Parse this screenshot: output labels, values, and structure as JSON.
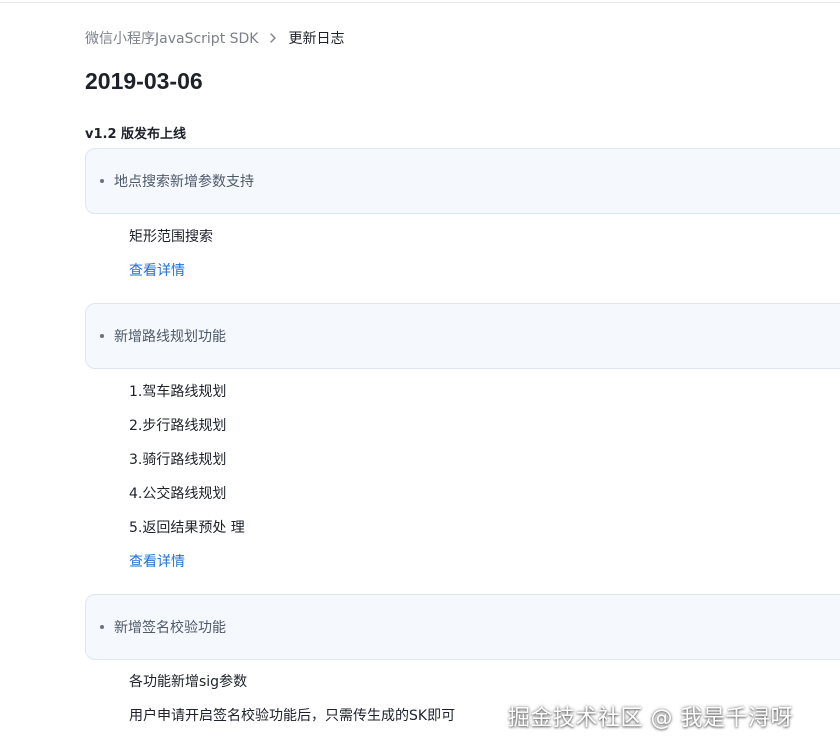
{
  "breadcrumb": {
    "parent": "微信小程序JavaScript SDK",
    "separator_icon": "chevron-right-icon",
    "current": "更新日志"
  },
  "page_title": "2019-03-06",
  "version_heading": "v1.2 版发布上线",
  "sections": [
    {
      "title": "地点搜索新增参数支持",
      "items": [
        "矩形范围搜索"
      ],
      "link": "查看详情"
    },
    {
      "title": "新增路线规划功能",
      "items": [
        "1.驾车路线规划",
        "2.步行路线规划",
        "3.骑行路线规划",
        "4.公交路线规划",
        "5.返回结果预处 理"
      ],
      "link": "查看详情"
    },
    {
      "title": "新增签名校验功能",
      "items": [
        "各功能新增sig参数",
        "用户申请开启签名校验功能后，只需传生成的SK即可"
      ]
    }
  ],
  "watermark": "掘金技术社区 @ 我是千浔呀",
  "colors": {
    "link": "#1e6fd9",
    "card_bg": "#f5f8fd",
    "card_border": "#dde6f3",
    "muted_text": "#7b8089"
  }
}
